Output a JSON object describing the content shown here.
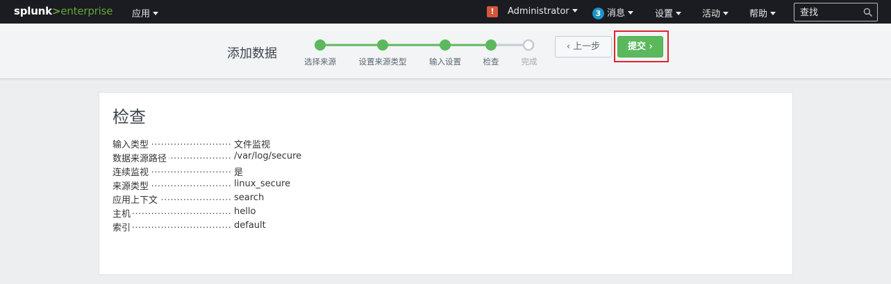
{
  "topnav": {
    "logo_main": "splunk",
    "logo_sep": ">",
    "logo_suffix": "enterprise",
    "apps_label": "应用",
    "alert_icon_glyph": "!",
    "user_label": "Administrator",
    "messages_count": "3",
    "messages_label": "消息",
    "settings_label": "设置",
    "activity_label": "活动",
    "help_label": "帮助",
    "search_placeholder": "查找"
  },
  "wizard": {
    "title": "添加数据",
    "steps": [
      {
        "label": "选择来源",
        "state": "done"
      },
      {
        "label": "设置来源类型",
        "state": "done"
      },
      {
        "label": "输入设置",
        "state": "done"
      },
      {
        "label": "检查",
        "state": "current"
      },
      {
        "label": "完成",
        "state": "pending"
      }
    ],
    "back_label": "上一步",
    "submit_label": "提交"
  },
  "review": {
    "title": "检查",
    "rows": [
      {
        "key": "输入类型",
        "value": "文件监视"
      },
      {
        "key": "数据来源路径",
        "value": "/var/log/secure"
      },
      {
        "key": "连续监视",
        "value": "是"
      },
      {
        "key": "来源类型",
        "value": "linux_secure"
      },
      {
        "key": "应用上下文",
        "value": "search"
      },
      {
        "key": "主机",
        "value": "hello"
      },
      {
        "key": "索引",
        "value": "default"
      }
    ]
  },
  "colors": {
    "nav_bg": "#1a1c21",
    "brand_green": "#65a637",
    "step_green": "#5cb85c",
    "submit_green": "#5cb85c",
    "alert_red": "#d6563c",
    "badge_blue": "#1e93c6",
    "highlight_red": "#e0232b"
  }
}
